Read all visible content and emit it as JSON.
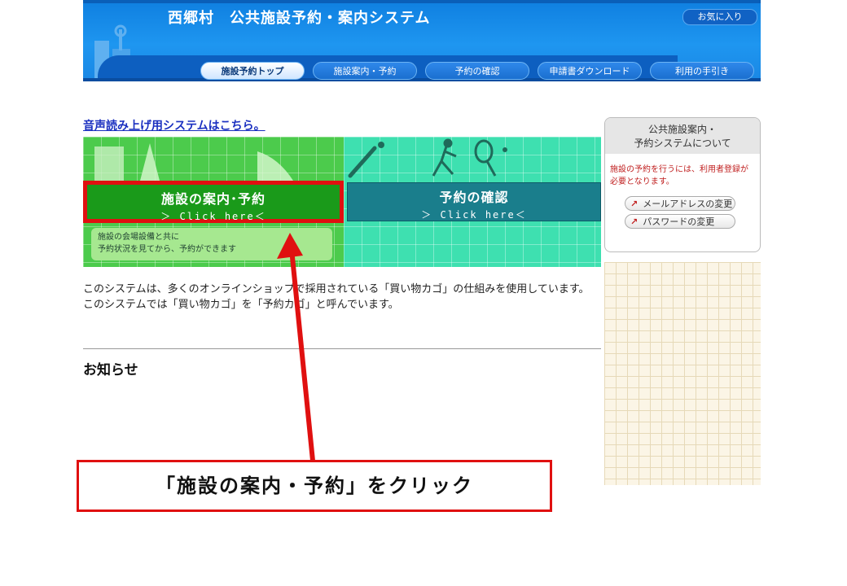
{
  "header": {
    "title": "西郷村　公共施設予約・案内システム",
    "favorites_label": "お気に入り"
  },
  "nav": {
    "tabs": [
      {
        "label": "施設予約トップ"
      },
      {
        "label": "施設案内・予約"
      },
      {
        "label": "予約の確認"
      },
      {
        "label": "申請書ダウンロード"
      },
      {
        "label": "利用の手引き"
      }
    ]
  },
  "voice_link": "音声読み上げ用システムはこちら。",
  "banner": {
    "main_button": {
      "title": "施設の案内･予約",
      "sub": "＞ Click here＜"
    },
    "confirm_button": {
      "title": "予約の確認",
      "sub": "＞ Click here＜"
    },
    "description": [
      "施設の会場設備と共に",
      "予約状況を見てから、予約ができます"
    ]
  },
  "body": {
    "line1": "このシステムは、多くのオンラインショップで採用されている「買い物カゴ」の仕組みを使用しています。",
    "line2": "このシステムでは「買い物カゴ」を「予約カゴ」と呼んでいます。",
    "news_title": "お知らせ"
  },
  "sidebar": {
    "heading": [
      "公共施設案内・",
      "予約システムについて"
    ],
    "note": "施設の予約を行うには、利用者登録が必要となります。",
    "buttons": [
      {
        "label": "メールアドレスの変更"
      },
      {
        "label": "パスワードの変更"
      }
    ]
  },
  "annotation": {
    "text": "「施設の案内・予約」をクリック",
    "color": "#e01010"
  }
}
